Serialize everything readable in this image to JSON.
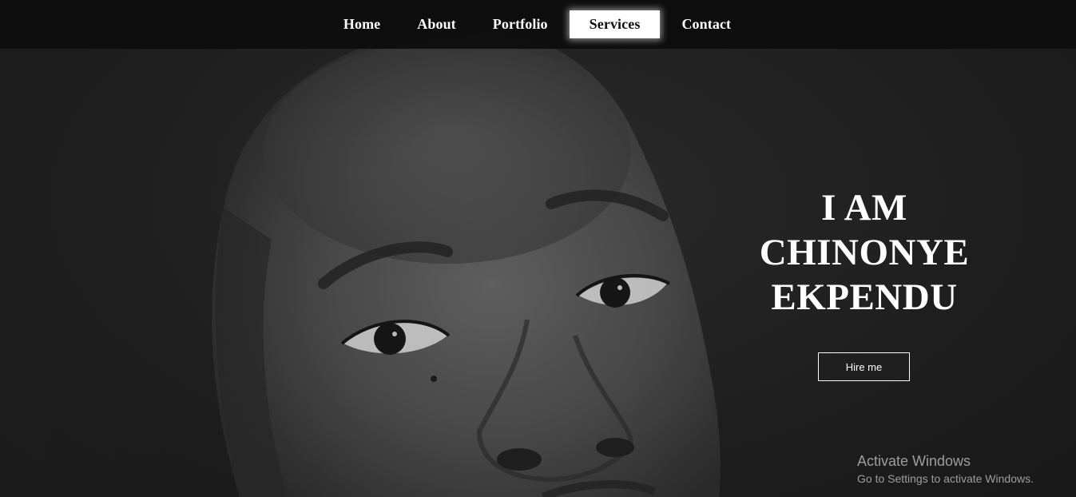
{
  "nav": {
    "items": [
      {
        "label": "Home",
        "active": false
      },
      {
        "label": "About",
        "active": false
      },
      {
        "label": "Portfolio",
        "active": false
      },
      {
        "label": "Services",
        "active": true
      },
      {
        "label": "Contact",
        "active": false
      }
    ]
  },
  "hero": {
    "title_lines": [
      "I AM",
      "CHINONYE",
      "EKPENDU"
    ],
    "cta_label": "Hire me"
  },
  "watermark": {
    "title": "Activate Windows",
    "subtitle": "Go to Settings to activate Windows."
  },
  "colors": {
    "nav_bg": "#0c0c0c",
    "text": "#ffffff",
    "active_bg": "#ffffff",
    "active_text": "#111111"
  }
}
